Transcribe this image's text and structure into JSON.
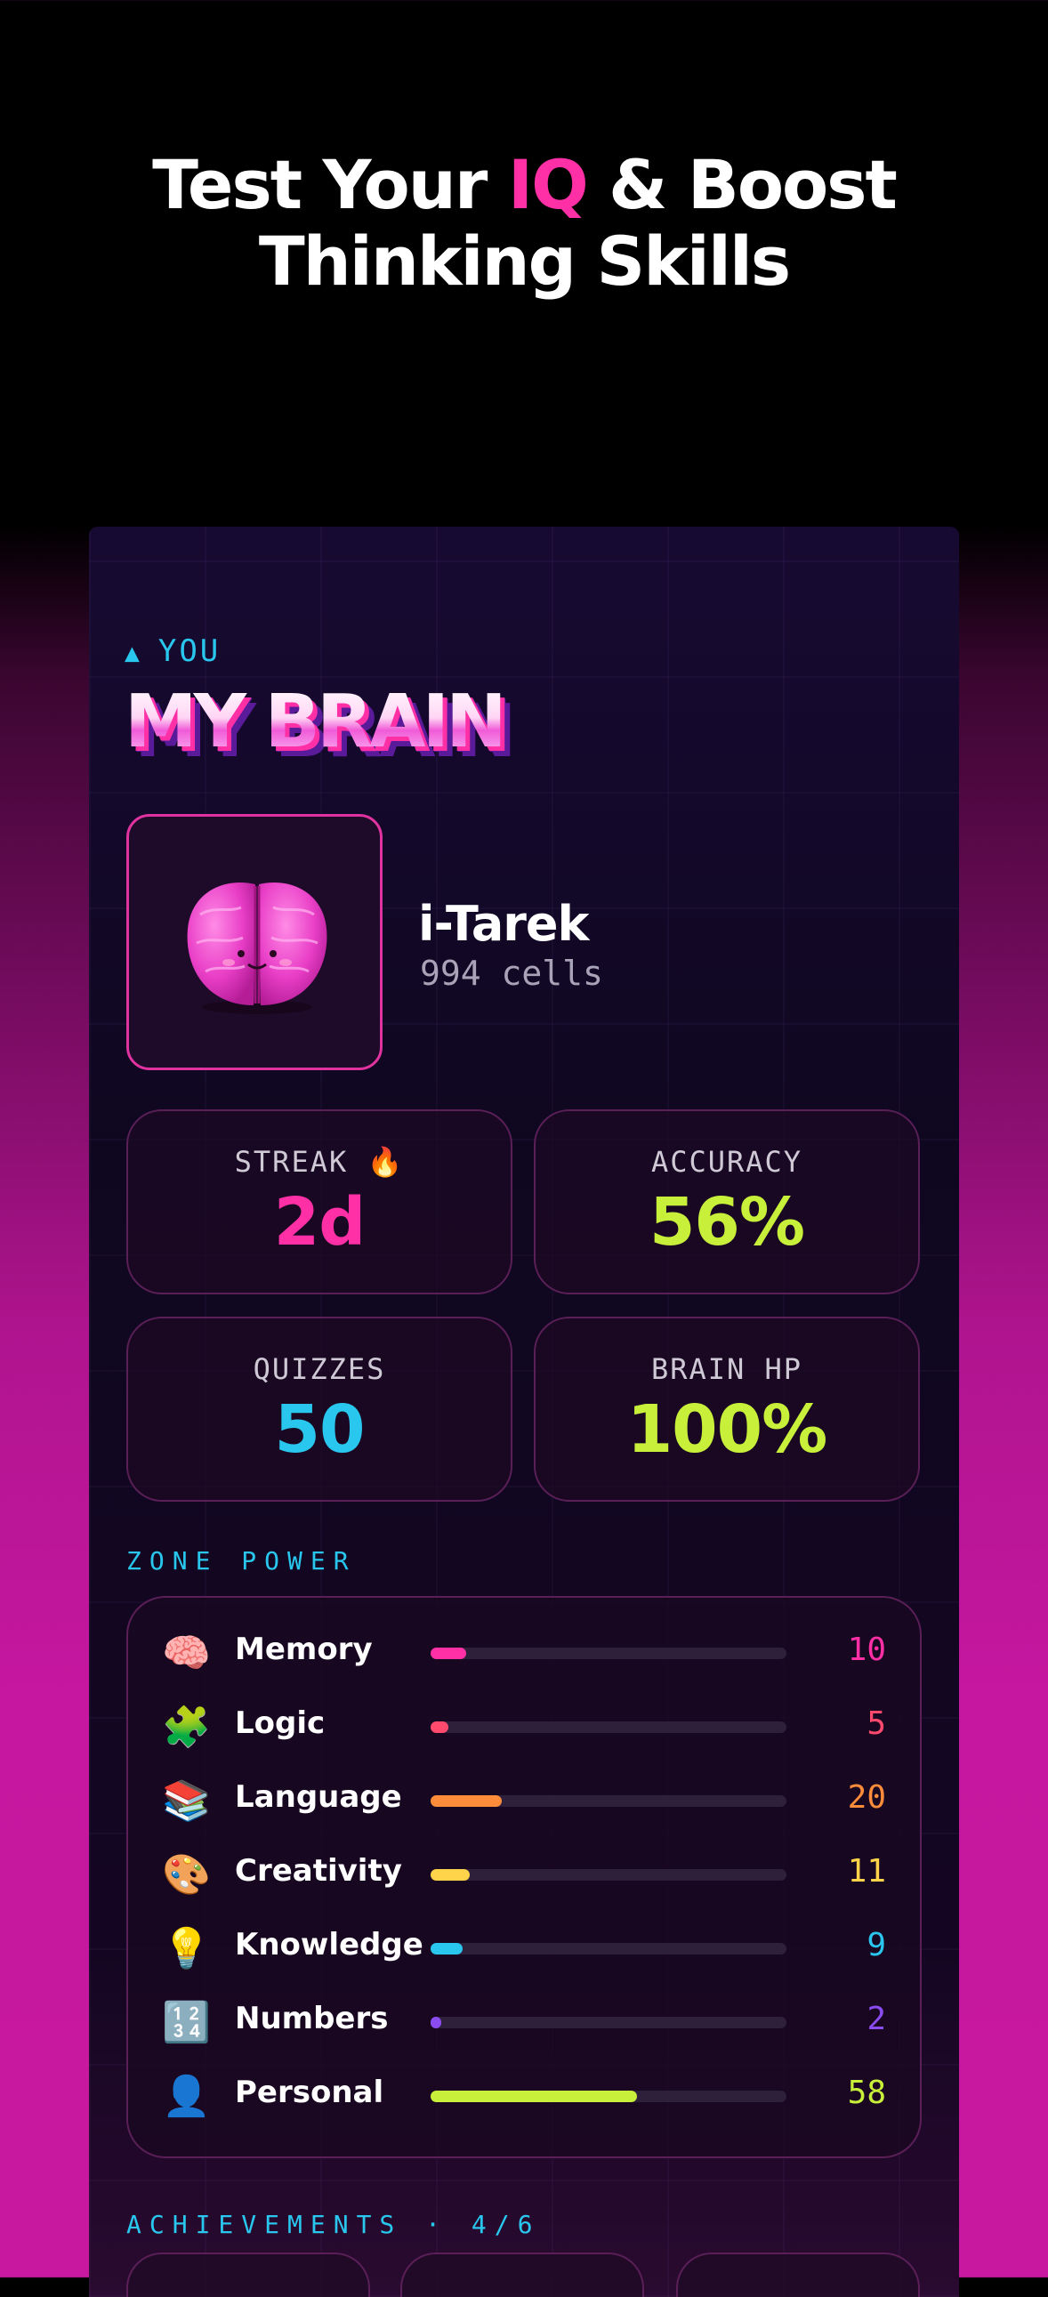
{
  "headline": {
    "line1_pre": "Test Your ",
    "line1_accent": "IQ",
    "line1_post": " & Boost",
    "line2": "Thinking Skills"
  },
  "section_you": {
    "marker": "▲",
    "label": "YOU"
  },
  "title": "MY BRAIN",
  "profile": {
    "username": "i-Tarek",
    "cells": "994 cells",
    "avatar_icon": "brain-icon"
  },
  "stats": [
    {
      "label": "STREAK 🔥",
      "value": "2d",
      "color": "#ff2fa6"
    },
    {
      "label": "ACCURACY",
      "value": "56%",
      "color": "#c8f03a"
    },
    {
      "label": "QUIZZES",
      "value": "50",
      "color": "#29c7ee"
    },
    {
      "label": "BRAIN HP",
      "value": "100%",
      "color": "#c8f03a"
    }
  ],
  "zone_power": {
    "label": "ZONE POWER",
    "items": [
      {
        "icon": "🧠",
        "icon_name": "brain-icon",
        "name": "Memory",
        "value": "10",
        "fraction": 0.1,
        "color": "#ff2fa6"
      },
      {
        "icon": "🧩",
        "icon_name": "puzzle-icon",
        "name": "Logic",
        "value": "5",
        "fraction": 0.05,
        "color": "#ff4a6e"
      },
      {
        "icon": "📚",
        "icon_name": "books-icon",
        "name": "Language",
        "value": "20",
        "fraction": 0.2,
        "color": "#ff8c3a"
      },
      {
        "icon": "🎨",
        "icon_name": "palette-icon",
        "name": "Creativity",
        "value": "11",
        "fraction": 0.11,
        "color": "#ffd44a"
      },
      {
        "icon": "💡",
        "icon_name": "lightbulb-icon",
        "name": "Knowledge",
        "value": "9",
        "fraction": 0.09,
        "color": "#29c7ee"
      },
      {
        "icon": "🔢",
        "icon_name": "numbers-icon",
        "name": "Numbers",
        "value": "2",
        "fraction": 0.02,
        "color": "#8a4cf0"
      },
      {
        "icon": "👤",
        "icon_name": "person-icon",
        "name": "Personal",
        "value": "58",
        "fraction": 0.58,
        "color": "#c8f03a"
      }
    ]
  },
  "achievements": {
    "label": "ACHIEVEMENTS",
    "separator": "·",
    "count": "4/6"
  }
}
